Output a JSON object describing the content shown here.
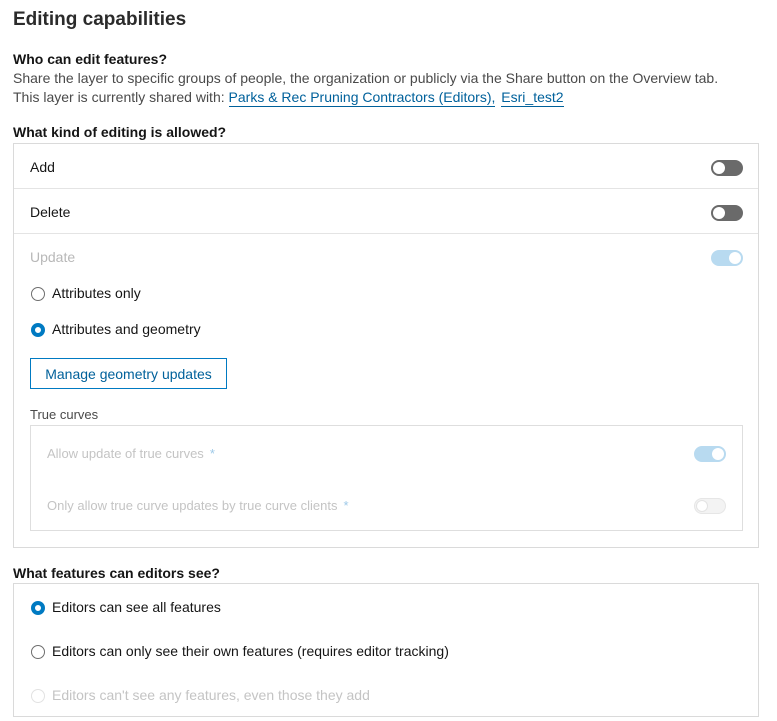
{
  "title": "Editing capabilities",
  "who_can_edit": {
    "heading": "Who can edit features?",
    "description": "Share the layer to specific groups of people, the organization or publicly via the Share button on the Overview tab.",
    "shared_prefix": "This layer is currently shared with:",
    "shared_groups": [
      "Parks & Rec Pruning Contractors (Editors),",
      "Esri_test2"
    ]
  },
  "editing_allowed": {
    "heading": "What kind of editing is allowed?",
    "add_label": "Add",
    "add_enabled": false,
    "delete_label": "Delete",
    "delete_enabled": false,
    "update_label": "Update",
    "update_enabled": true,
    "update_options": [
      "Attributes only",
      "Attributes and geometry"
    ],
    "update_selected": "Attributes and geometry",
    "manage_button": "Manage geometry updates",
    "true_curves": {
      "label": "True curves",
      "allow_update_label": "Allow update of true curves",
      "allow_update_enabled": true,
      "only_clients_label": "Only allow true curve updates by true curve clients",
      "only_clients_enabled": false,
      "required_marker": "*"
    }
  },
  "visibility": {
    "heading": "What features can editors see?",
    "options": [
      "Editors can see all features",
      "Editors can only see their own features (requires editor tracking)",
      "Editors can't see any features, even those they add"
    ],
    "selected": "Editors can see all features"
  },
  "colors": {
    "accent": "#007ac2",
    "link": "#00619b",
    "toggle_off": "#6a6a6a",
    "border": "#dadada"
  }
}
